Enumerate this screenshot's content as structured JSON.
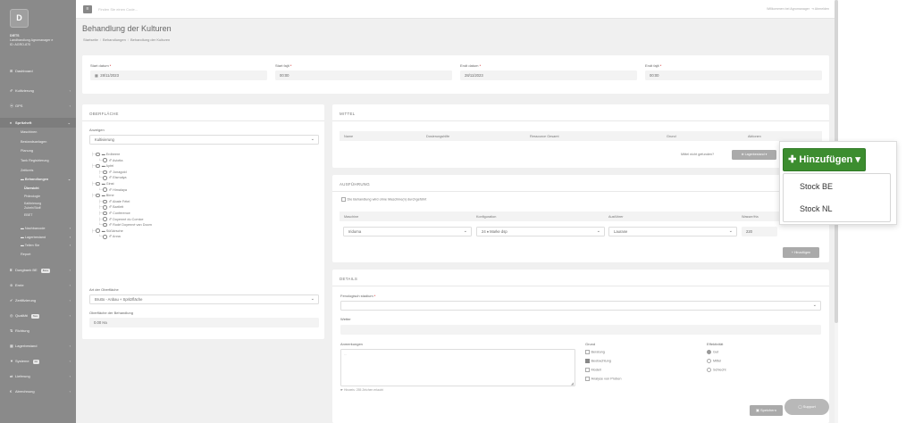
{
  "sidebar": {
    "logo_letter": "D",
    "user": {
      "name": "DIETS",
      "line1": "Landhandlung Agromanager e",
      "line2": "ID: AGRO-870"
    },
    "nav": [
      {
        "icon": "dashboard-icon",
        "glyph": "⊞",
        "label": "Dashboard",
        "chevron": false
      },
      {
        "icon": "leaf-icon",
        "glyph": "✐",
        "label": "Kultivierung",
        "chevron": true
      },
      {
        "icon": "gps-icon",
        "glyph": "⦿",
        "label": "GPS",
        "chevron": true
      },
      {
        "icon": "tractor-icon",
        "glyph": "♦",
        "label": "Spritzheft",
        "chevron": true
      }
    ],
    "sub": {
      "maschinen": "Maschinen",
      "bestaende": "Bestandsanlagen",
      "planung": "Planung",
      "tank": "Tank Registrierung",
      "zeitkreis": "Zeitkreis",
      "behandlungen": "Behandlungen",
      "uebersicht": "Übersicht",
      "phenologie": "Phänologie",
      "kalibrierung_1": "Kalibrierung",
      "kalibrierung_2": "Zubeh/Stoff",
      "ebet": "EBET",
      "nachbarschaft": "Nachbarcode",
      "lagerbestand": "Lagerbestand",
      "teile": "Teilen Sie",
      "report": "Report"
    },
    "nav2": [
      {
        "icon": "fertilizer-icon",
        "glyph": "⌸",
        "label": "Dungbank BE",
        "badge": "Beta",
        "chevron": true
      },
      {
        "icon": "harvest-icon",
        "glyph": "⊜",
        "label": "Ernte",
        "chevron": true
      },
      {
        "icon": "certificate-icon",
        "glyph": "✔",
        "label": "Zertifizierung",
        "chevron": true
      },
      {
        "icon": "quality-icon",
        "glyph": "◎",
        "label": "Qualität",
        "badge": "Neu",
        "chevron": true
      },
      {
        "icon": "direction-icon",
        "glyph": "⇅",
        "label": "Richtung",
        "chevron": false
      },
      {
        "icon": "stock-icon",
        "glyph": "▦",
        "label": "Lagerbestand",
        "chevron": true
      },
      {
        "icon": "system-icon",
        "glyph": "▼",
        "label": "Systeme",
        "badge": "02",
        "chevron": true
      },
      {
        "icon": "delivery-icon",
        "glyph": "⇄",
        "label": "Lieferung",
        "chevron": true
      },
      {
        "icon": "billing-icon",
        "glyph": "€",
        "label": "Abrechnung",
        "chevron": true
      }
    ]
  },
  "topbar": {
    "search_placeholder": "Finden Sie einen Code...",
    "welcome": "Willkommen bei Agromanager",
    "logout": "⇥ Abmelden"
  },
  "page": {
    "title": "Behandlung der Kulturen",
    "breadcrumb": [
      "Startseite",
      "Behandlungen",
      "Behandlung der Kulturen"
    ]
  },
  "dates": {
    "start_date_label": "Start datum",
    "start_date": "28/11/2023",
    "start_time_label": "Start fajit",
    "start_time": "00:00",
    "end_date_label": "Endt datum",
    "end_date": "28/11/2023",
    "end_time_label": "Endt fajit",
    "end_time": "00:00"
  },
  "surface": {
    "section": "OBERFLÄCHE",
    "display_label": "Anzeigen",
    "display_value": "Kultivierung",
    "tree": [
      {
        "indent": 0,
        "label": "Erdbeere"
      },
      {
        "indent": 1,
        "label": "Aviotta"
      },
      {
        "indent": 0,
        "label": "Apfel"
      },
      {
        "indent": 1,
        "label": "Jonagold"
      },
      {
        "indent": 1,
        "label": "Elsmalya"
      },
      {
        "indent": 0,
        "label": "Ginst"
      },
      {
        "indent": 1,
        "label": "Himalaya"
      },
      {
        "indent": 0,
        "label": "Birne"
      },
      {
        "indent": 1,
        "label": "Abate Fétel"
      },
      {
        "indent": 1,
        "label": "Bartlett"
      },
      {
        "indent": 1,
        "label": "Conference"
      },
      {
        "indent": 1,
        "label": "Doyenné du Comice"
      },
      {
        "indent": 1,
        "label": "Rodé Doyenné van Doorn"
      },
      {
        "indent": 0,
        "label": "Süßkirsche"
      },
      {
        "indent": 1,
        "label": "Anna"
      }
    ],
    "type_label": "Art der Oberfläche",
    "type_value": "Brutto - Anbau + Spritzfläche",
    "area_label": "Oberfläche der Behandlung",
    "area_value": "0.00 Ha"
  },
  "mittel": {
    "section": "MITTEL",
    "columns": [
      "Name",
      "Dosierungshilfe",
      "Ressource Gesamt",
      "Grund",
      "Aktionen"
    ],
    "not_found": "Mittel nicht gefunden?",
    "stock_button": "⊕ Lagerbestand ▾"
  },
  "ausfuehrung": {
    "section": "AUSFÜHRUNG",
    "checkbox_label": "Die Behandlung wird ohne Maschine(n) durchgeführt",
    "columns": [
      "Maschine",
      "Konfiguration",
      "Ausführer",
      "Wasser/Ha"
    ],
    "row": {
      "machine": "Iridurna",
      "config": "24 ♦ Marke dsp",
      "executor": "Laurane",
      "water": "220"
    },
    "add_button": "+ Hinzufügen"
  },
  "details": {
    "section": "DETAILS",
    "phenology_label": "Fenologisch stadium",
    "weather_label": "Wetter",
    "notes_label": "Anmerkungen",
    "notes_hint": "☛ Hinweis: 255 Zeichen erlaubt",
    "grund_label": "Grund",
    "grund_options": [
      {
        "label": "Beratung",
        "checked": false
      },
      {
        "label": "Beobachtung",
        "checked": true
      },
      {
        "label": "Modell",
        "checked": false
      },
      {
        "label": "Analyse von Proben",
        "checked": false
      }
    ],
    "eff_label": "Effektivität",
    "eff_options": [
      {
        "label": "Gut",
        "checked": true
      },
      {
        "label": "Mittel",
        "checked": false
      },
      {
        "label": "Schlecht",
        "checked": false
      }
    ],
    "save_button": "▣ Speichern"
  },
  "dropdown": {
    "button_label": "✚ Hinzufügen ▾",
    "items": [
      "Stock BE",
      "Stock NL"
    ]
  },
  "support_button": "◯ Support",
  "colors": {
    "accent_green": "#3c8d2f",
    "sidebar": "#8a8a8a"
  }
}
